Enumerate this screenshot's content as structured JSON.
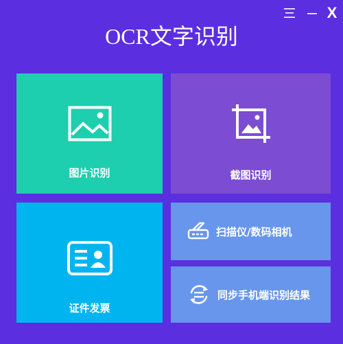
{
  "window": {
    "title": "OCR文字识别",
    "controls": {
      "menu": "三",
      "minimize": "—",
      "close": "X"
    }
  },
  "tiles": {
    "image": {
      "label": "图片识别",
      "icon": "image-icon"
    },
    "screenshot": {
      "label": "截图识别",
      "icon": "crop-image-icon"
    },
    "id": {
      "label": "证件发票",
      "icon": "id-card-icon"
    },
    "scanner": {
      "label": "扫描仪/数码相机",
      "icon": "scanner-icon"
    },
    "sync": {
      "label": "同步手机端识别结果",
      "icon": "sync-icon"
    }
  },
  "colors": {
    "background": "#5b2ee0",
    "image_tile": "#1dcfae",
    "screenshot_tile": "#7c4cd3",
    "id_tile": "#00b5ef",
    "small_tile": "#6796ec"
  }
}
